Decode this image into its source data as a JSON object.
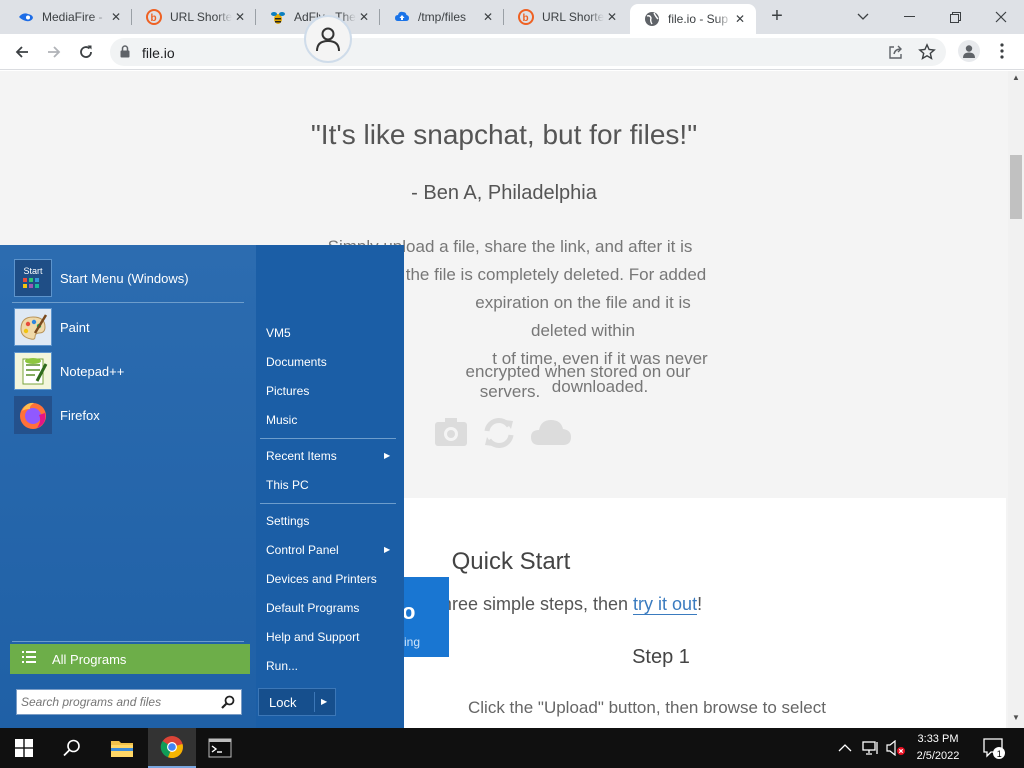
{
  "browser": {
    "tabs": [
      {
        "title": "MediaFire -",
        "icon": "mediafire-icon",
        "color": "#1d6ce6"
      },
      {
        "title": "URL Shorte",
        "icon": "bitly-icon",
        "color": "#ee6123"
      },
      {
        "title": "AdFly - The",
        "icon": "adfly-icon",
        "color": "#0b7fc0"
      },
      {
        "title": "/tmp/files",
        "icon": "cloud-upload-icon",
        "color": "#1a73e8"
      },
      {
        "title": "URL Shorte",
        "icon": "bitly-icon",
        "color": "#ee6123"
      },
      {
        "title": "file.io - Sup",
        "icon": "globe-icon",
        "color": "#5f6368"
      }
    ],
    "active_tab": 5,
    "url": "file.io"
  },
  "page": {
    "quote": "\"It's like snapchat, but for files!\"",
    "author": "- Ben A, Philadelphia",
    "description_lines": [
      "Simply upload a file, share the link, and after it is",
      "the file is completely deleted. For added",
      "expiration on the file and it is deleted within",
      "t of time, even if it was never downloaded."
    ],
    "encryption_text": "encrypted when stored on our servers.",
    "quick_start": {
      "title": "Quick Start",
      "subtitle_prefix": "s with file.io in three simple steps, then ",
      "subtitle_link": "try it out",
      "subtitle_suffix": "!",
      "step_title": "Step 1",
      "step_text": "Click the \"Upload\" button, then browse to select",
      "logo_fragment": "o",
      "logo_sub": "ring"
    }
  },
  "start_menu": {
    "pinned": [
      {
        "label": "Start Menu (Windows)",
        "icon": "start-menu-icon"
      },
      {
        "label": "Paint",
        "icon": "paint-icon"
      },
      {
        "label": "Notepad++",
        "icon": "notepadpp-icon"
      },
      {
        "label": "Firefox",
        "icon": "firefox-icon"
      }
    ],
    "start_icon_text": "Start",
    "all_programs": "All Programs",
    "search_placeholder": "Search programs and files",
    "right_items": [
      {
        "label": "VM5",
        "submenu": false
      },
      {
        "label": "Documents",
        "submenu": false
      },
      {
        "label": "Pictures",
        "submenu": false
      },
      {
        "label": "Music",
        "submenu": false
      },
      {
        "label": "Recent Items",
        "submenu": true
      },
      {
        "label": "This PC",
        "submenu": false
      },
      {
        "label": "Settings",
        "submenu": false
      },
      {
        "label": "Control Panel",
        "submenu": true
      },
      {
        "label": "Devices and Printers",
        "submenu": false
      },
      {
        "label": "Default Programs",
        "submenu": false
      },
      {
        "label": "Help and Support",
        "submenu": false
      },
      {
        "label": "Run...",
        "submenu": false
      }
    ],
    "lock_label": "Lock"
  },
  "taskbar": {
    "time": "3:33 PM",
    "date": "2/5/2022",
    "notification_count": "1"
  }
}
